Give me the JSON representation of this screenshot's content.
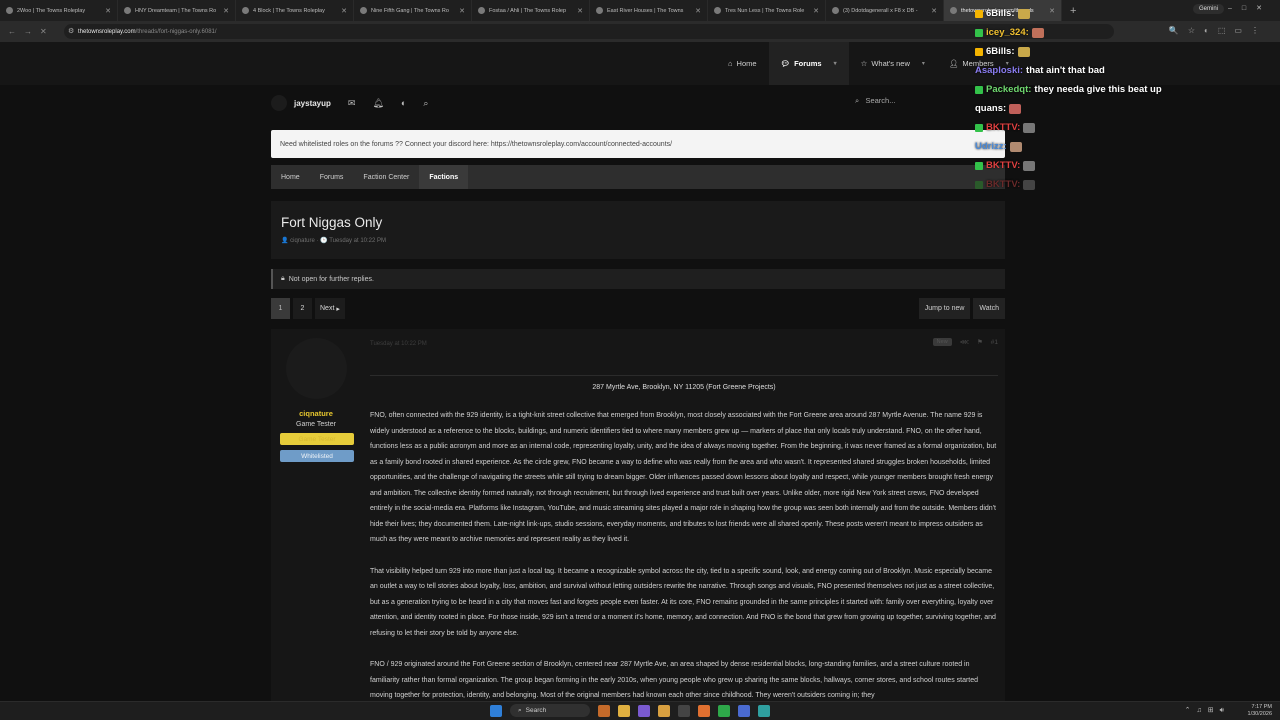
{
  "browser": {
    "tabs": [
      {
        "title": "2Woo | The Towns Roleplay",
        "active": false
      },
      {
        "title": "HNY Dreamteam | The Towns Ro",
        "active": false
      },
      {
        "title": "4 Block | The Towns Roleplay",
        "active": false
      },
      {
        "title": "Nine Fifth Gang | The Towns Ro",
        "active": false
      },
      {
        "title": "Fostaa / Ahli | The Towns Rolep",
        "active": false
      },
      {
        "title": "East River Houses | The Towns",
        "active": false
      },
      {
        "title": "Tres Nun Less | The Towns Role",
        "active": false
      },
      {
        "title": "(3) Ddotdagenerall x F8 x DB -",
        "active": false
      },
      {
        "title": "thetownsroleplay.com/threads",
        "active": true
      }
    ],
    "new_tab": "+",
    "gemini": "Gemini",
    "url_host": "thetownsroleplay.com",
    "url_path": "/threads/fort-niggas-only.6081/"
  },
  "site": {
    "nav": [
      {
        "label": "Home",
        "icon": "home-icon",
        "selected": false
      },
      {
        "label": "Forums",
        "icon": "forums-icon",
        "selected": true
      },
      {
        "label": "What's new",
        "icon": "star-icon",
        "selected": false
      },
      {
        "label": "Members",
        "icon": "user-icon",
        "selected": false
      }
    ],
    "username": "jaystayup",
    "search_placeholder": "Search...",
    "notice": "Need whitelisted roles on the forums ?? Connect your discord here: https://thetownsroleplay.com/account/connected-accounts/",
    "breadcrumbs": [
      "Home",
      "Forums",
      "Faction Center",
      "Factions"
    ]
  },
  "thread": {
    "title": "Fort Niggas Only",
    "author": "ciqnature",
    "date": "Tuesday at 10:22 PM",
    "locked_text": "Not open for further replies.",
    "pages": [
      "1",
      "2"
    ],
    "next_label": "Next",
    "jump_label": "Jump to new",
    "watch_label": "Watch"
  },
  "post": {
    "author": "ciqnature",
    "user_title": "Game Tester",
    "banners": [
      "Game Tester",
      "Whitelisted"
    ],
    "date": "Tuesday at 10:22 PM",
    "new_tag": "New",
    "post_number": "#1",
    "address": "287 Myrtle Ave, Brooklyn, NY 11205 (Fort Greene Projects)",
    "paragraphs": [
      "FNO, often connected with the 929 identity, is a tight-knit street collective that emerged from Brooklyn, most closely associated with the Fort Greene area around 287 Myrtle Avenue. The name 929 is widely understood as a reference to the blocks, buildings, and numeric identifiers tied to where many members grew up — markers of place that only locals truly understand. FNO, on the other hand, functions less as a public acronym and more as an internal code, representing loyalty, unity, and the idea of always moving together. From the beginning, it was never framed as a formal organization, but as a family bond rooted in shared experience. As the circle grew, FNO became a way to define who was really from the area and who wasn't. It represented shared struggles broken households, limited opportunities, and the challenge of navigating the streets while still trying to dream bigger. Older influences passed down lessons about loyalty and respect, while younger members brought fresh energy and ambition. The collective identity formed naturally, not through recruitment, but through lived experience and trust built over years. Unlike older, more rigid New York street crews, FNO developed entirely in the social-media era. Platforms like Instagram, YouTube, and music streaming sites played a major role in shaping how the group was seen both internally and from the outside. Members didn't hide their lives; they documented them. Late-night link-ups, studio sessions, everyday moments, and tributes to lost friends were all shared openly. These posts weren't meant to impress outsiders as much as they were meant to archive memories and represent reality as they lived it.",
      "That visibility helped turn 929 into more than just a local tag. It became a recognizable symbol across the city, tied to a specific sound, look, and energy coming out of Brooklyn. Music especially became an outlet a way to tell stories about loyalty, loss, ambition, and survival without letting outsiders rewrite the narrative. Through songs and visuals, FNO presented themselves not just as a street collective, but as a generation trying to be heard in a city that moves fast and forgets people even faster. At its core, FNO remains grounded in the same principles it started with: family over everything, loyalty over attention, and identity rooted in place. For those inside, 929 isn't a trend or a moment it's home, memory, and connection. And FNO is the bond that grew from growing up together, surviving together, and refusing to let their story be told by anyone else.",
      "FNO / 929 originated around the Fort Greene section of Brooklyn, centered near 287 Myrtle Ave, an area shaped by dense residential blocks, long-standing families, and a street culture rooted in familiarity rather than formal organization. The group began forming in the early 2010s, when young people who grew up sharing the same blocks, hallways, corner stores, and school routes started moving together for protection, identity, and belonging. Most of the original members had known each other since childhood. They weren't outsiders coming in; they"
    ]
  },
  "chat": [
    {
      "user": "6Bills:",
      "color": "#ffffff",
      "msg": "",
      "badge": "#f5b400",
      "emote": "#c9a94a"
    },
    {
      "user": "icey_324:",
      "color": "#f0c030",
      "msg": "",
      "badge": "#33c24a",
      "emote": "#c0705a"
    },
    {
      "user": "6Bills:",
      "color": "#ffffff",
      "msg": "",
      "badge": "#f5b400",
      "emote": "#c9a94a"
    },
    {
      "user": "Asaploski:",
      "color": "#8a7cf0",
      "msg": "that ain't that bad",
      "badge": "",
      "emote": ""
    },
    {
      "user": "Packedqt:",
      "color": "#6fd86f",
      "msg": "they needa give this beat up",
      "badge": "#33c24a",
      "emote": ""
    },
    {
      "user": "quans:",
      "color": "#ffffff",
      "msg": "",
      "badge": "",
      "emote": "#c0605a"
    },
    {
      "user": "BKTTV:",
      "color": "#e04040",
      "msg": "",
      "badge": "#33c24a",
      "emote": "#777777"
    },
    {
      "user": "Udrizz:",
      "color": "#4a8ad8",
      "msg": "",
      "badge": "",
      "emote": "#b08a70"
    },
    {
      "user": "BKTTV:",
      "color": "#e04040",
      "msg": "",
      "badge": "#33c24a",
      "emote": "#777777"
    },
    {
      "user": "BKTTV:",
      "color": "#6a2a2a",
      "msg": "",
      "badge": "#2a5a2a",
      "emote": "#444444"
    }
  ],
  "taskbar": {
    "search": "Search",
    "time": "7:17 PM",
    "date": "1/30/2026"
  }
}
